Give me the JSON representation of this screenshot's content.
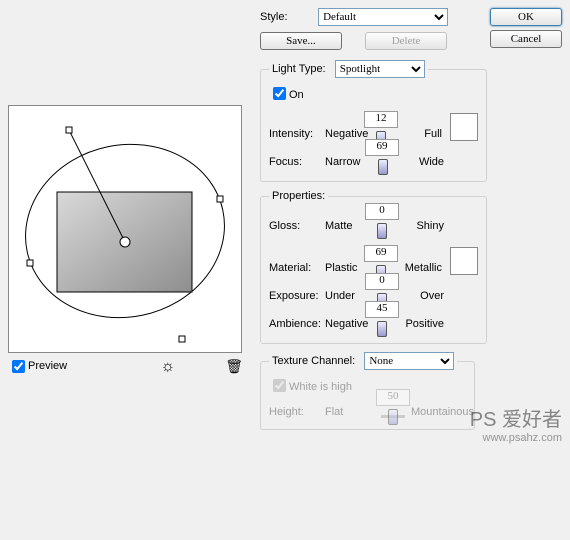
{
  "buttons": {
    "ok": "OK",
    "cancel": "Cancel",
    "save": "Save...",
    "delete": "Delete"
  },
  "style": {
    "label": "Style:",
    "value": "Default"
  },
  "light": {
    "legend": "Light Type:",
    "value": "Spotlight",
    "on": "On",
    "on_checked": true,
    "intensity": {
      "label": "Intensity:",
      "left": "Negative",
      "right": "Full",
      "value": "12",
      "pos": 56
    },
    "focus": {
      "label": "Focus:",
      "left": "Narrow",
      "right": "Wide",
      "value": "69",
      "pos": 85
    }
  },
  "props": {
    "legend": "Properties:",
    "gloss": {
      "label": "Gloss:",
      "left": "Matte",
      "right": "Shiny",
      "value": "0",
      "pos": 50
    },
    "material": {
      "label": "Material:",
      "left": "Plastic",
      "right": "Metallic",
      "value": "69",
      "pos": 85
    },
    "exposure": {
      "label": "Exposure:",
      "left": "Under",
      "right": "Over",
      "value": "0",
      "pos": 50
    },
    "ambience": {
      "label": "Ambience:",
      "left": "Negative",
      "right": "Positive",
      "value": "45",
      "pos": 72
    }
  },
  "texture": {
    "legend": "Texture Channel:",
    "value": "None",
    "white": "White is high",
    "white_checked": true,
    "height": {
      "label": "Height:",
      "left": "Flat",
      "right": "Mountainous",
      "value": "50",
      "pos": 50
    }
  },
  "preview": {
    "label": "Preview",
    "checked": true
  },
  "watermark": {
    "text": "PS 爱好者",
    "url": "www.psahz.com"
  }
}
